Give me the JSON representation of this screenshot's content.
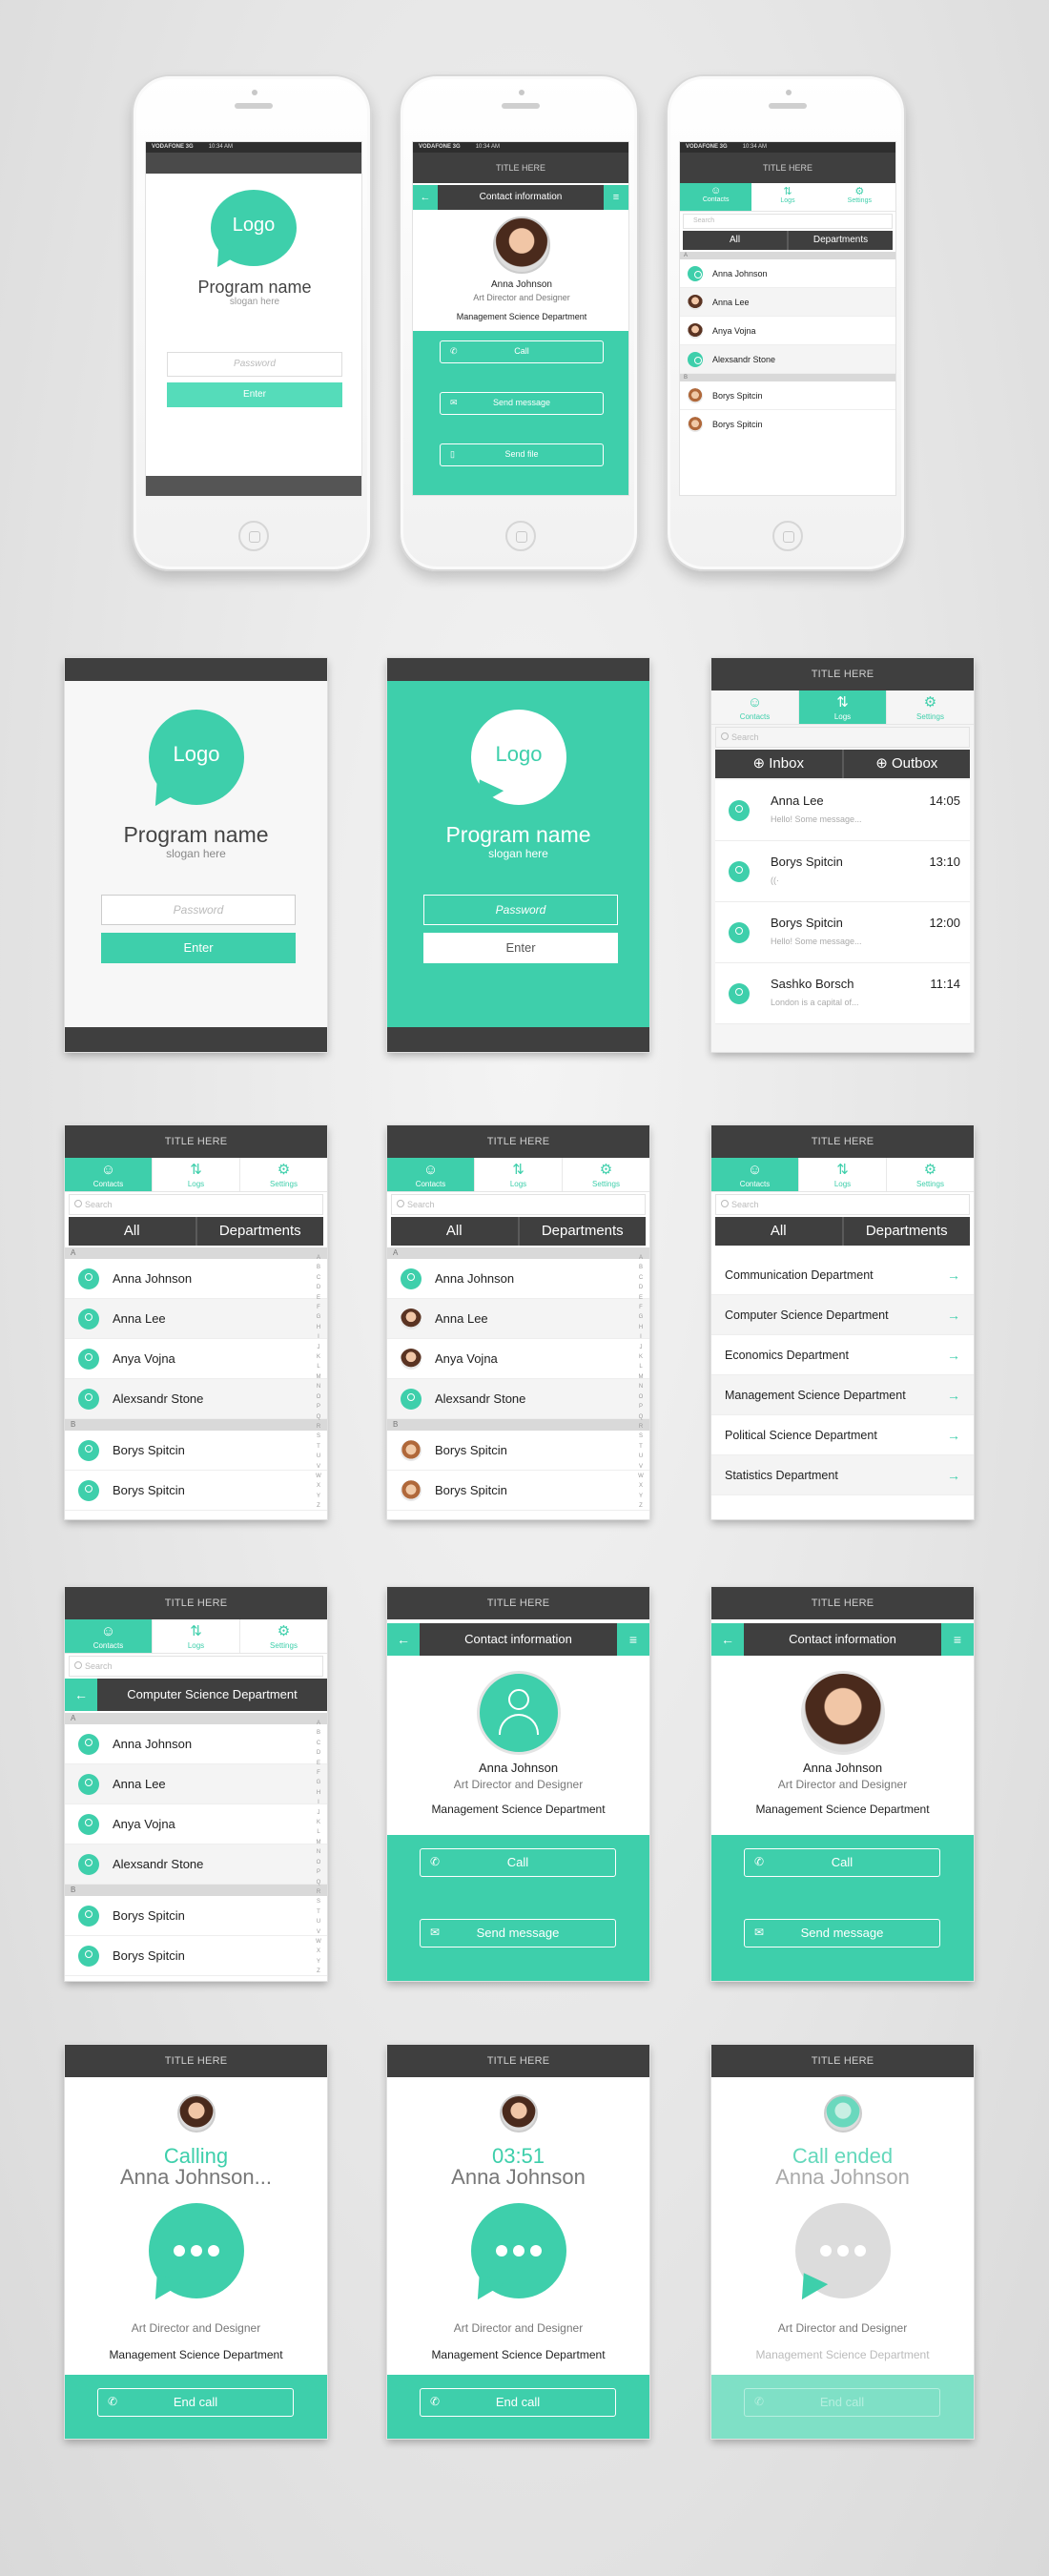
{
  "status": {
    "carrier": "VODAFONE  3G",
    "time": "10:34 AM"
  },
  "common": {
    "title": "TITLE HERE",
    "logo": "Logo",
    "program": "Program name",
    "slogan": "slogan here",
    "password_placeholder": "Password",
    "enter": "Enter",
    "contact_info": "Contact information",
    "search": "Search",
    "tabs": [
      "Contacts",
      "Logs",
      "Settings"
    ],
    "seg_all": "All",
    "seg_departments": "Departments",
    "inbox": "Inbox",
    "outbox": "Outbox",
    "name": "Anna Johnson",
    "role": "Art Director and Designer",
    "department": "Management Science Department",
    "call": "Call",
    "send_message": "Send message",
    "send_file": "Send file",
    "end_call": "End call",
    "calling": "Calling",
    "calling_name": "Anna Johnson...",
    "timer": "03:51",
    "call_ended": "Call ended",
    "comp_dept": "Computer Science Department",
    "letter_a": "A",
    "letter_b": "B",
    "alphabet": [
      "A",
      "B",
      "C",
      "D",
      "E",
      "F",
      "G",
      "H",
      "I",
      "J",
      "K",
      "L",
      "M",
      "N",
      "O",
      "P",
      "Q",
      "R",
      "S",
      "T",
      "U",
      "V",
      "W",
      "X",
      "Y",
      "Z"
    ]
  },
  "contacts": [
    "Anna Johnson",
    "Anna Lee",
    "Anya Vojna",
    "Alexsandr Stone",
    "Borys Spitcin",
    "Borys Spitcin"
  ],
  "contacts_phone": [
    "Anna Johnson",
    "Anna Lee",
    "Anya Vojna",
    "Alexsandr Stone",
    "Borys Spitcin",
    "Borys Spitcin"
  ],
  "departments": [
    "Communication Department",
    "Computer Science Department",
    "Economics Department",
    "Management Science Department",
    "Political Science Department",
    "Statistics Department"
  ],
  "logs": [
    {
      "name": "Anna Lee",
      "time": "14:05",
      "preview": "Hello! Some message..."
    },
    {
      "name": "Borys Spitcin",
      "time": "13:10",
      "preview": "((·"
    },
    {
      "name": "Borys Spitcin",
      "time": "12:00",
      "preview": "Hello! Some message..."
    },
    {
      "name": "Sashko Borsch",
      "time": "11:14",
      "preview": "London is a capital of..."
    }
  ],
  "colors": {
    "accent": "#3ecfab",
    "dark": "#3f3f3f"
  }
}
